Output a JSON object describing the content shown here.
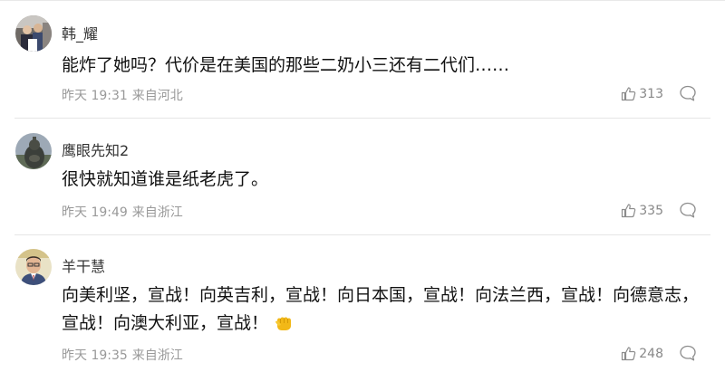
{
  "comments": [
    {
      "username": "韩_耀",
      "text": "能炸了她吗？代价是在美国的那些二奶小三还有二代们……",
      "time": "昨天 19:31",
      "location": "来自河北",
      "likes": "313",
      "avatar_icon": "user-avatar-photo-group"
    },
    {
      "username": "鹰眼先知2",
      "text": "很快就知道谁是纸老虎了。",
      "time": "昨天 19:49",
      "location": "来自浙江",
      "likes": "335",
      "avatar_icon": "user-avatar-statue"
    },
    {
      "username": "羊干慧",
      "text": "向美利坚，宣战！向英吉利，宣战！向日本国，宣战！向法兰西，宣战！向德意志，宣战！向澳大利亚，宣战！",
      "time": "昨天 19:35",
      "location": "来自浙江",
      "likes": "248",
      "avatar_icon": "user-avatar-portrait",
      "trailing_emoji": "fist-emoji"
    }
  ],
  "colors": {
    "username": "#333333",
    "text": "#111111",
    "meta": "#999999",
    "divider": "#e6e6e6",
    "emoji": "#f2b817"
  }
}
